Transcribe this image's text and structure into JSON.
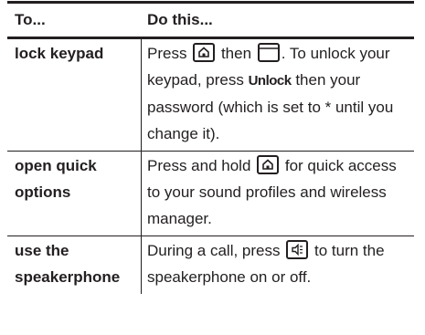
{
  "header": {
    "col1": "To...",
    "col2": "Do this..."
  },
  "rows": [
    {
      "task": "lock keypad",
      "text_1": "Press",
      "text_2": "then",
      "text_3": ". To unlock your keypad, press",
      "softkey": "Unlock",
      "text_4": "then your password (which is set to * until you change it)."
    },
    {
      "task_line1": "open quick",
      "task_line2": "options",
      "text_1": "Press and hold",
      "text_2": "for quick access to your sound profiles and wireless manager."
    },
    {
      "task_line1": "use the",
      "task_line2": "speakerphone",
      "text_1": "During a call, press",
      "text_2": "to turn the speakerphone on or off."
    }
  ],
  "icons": {
    "home_key": "home-key-icon",
    "menu_key": "softkey-bar-icon",
    "speaker_key": "speaker-key-icon"
  }
}
